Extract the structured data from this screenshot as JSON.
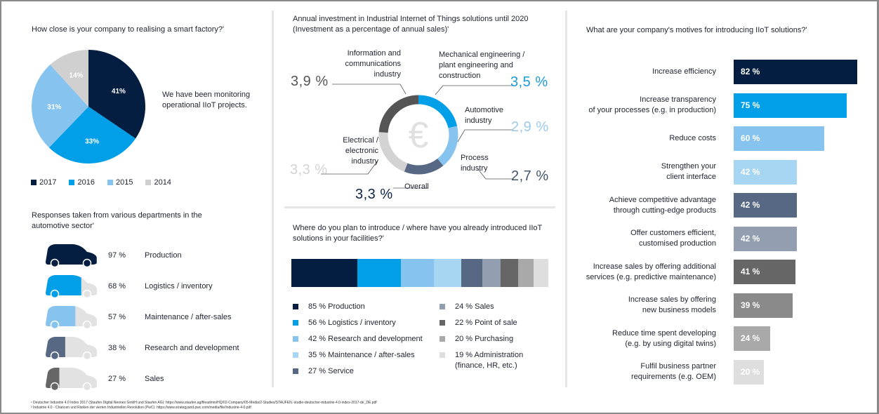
{
  "colors": {
    "navy": "#041e42",
    "blue": "#009fe8",
    "lightblue": "#87c3ef",
    "paleblue": "#a7d6f3",
    "slate": "#566883",
    "greyblue": "#939fb0",
    "darkgrey": "#666666",
    "midgrey": "#a9a9a9",
    "lightgrey": "#dedede",
    "pie2014": "#d0d0d0",
    "inactive": "#e2e2e2"
  },
  "chart_data": [
    {
      "type": "pie",
      "title": "How close is your company to realising a smart factory?'",
      "annotation": "We have been monitoring operational IIoT projects.",
      "categories": [
        "2017",
        "2016",
        "2015",
        "2014"
      ],
      "values": [
        41,
        33,
        31,
        14
      ],
      "labels": [
        "41%",
        "33%",
        "31%",
        "14%"
      ],
      "legend": "bottom"
    },
    {
      "type": "bar",
      "title": "Responses taken from various departments in the automotive sector'",
      "categories": [
        "Production",
        "Logistics / inventory",
        "Maintenance / after-sales",
        "Research and development",
        "Sales"
      ],
      "values": [
        97,
        68,
        57,
        38,
        27
      ],
      "labels": [
        "97 %",
        "68 %",
        "57 %",
        "38 %",
        "27 %"
      ]
    },
    {
      "type": "pie",
      "title": "Annual investment in Industrial Internet of Things solutions until 2020 (Investment as a percentage of annual sales)'",
      "categories": [
        "Mechanical engineering / plant engineering and construction",
        "Automotive industry",
        "Process industry",
        "Electrical / electronic industry",
        "Information and communications industry"
      ],
      "values": [
        3.5,
        2.9,
        2.7,
        3.3,
        3.9
      ],
      "labels": [
        "3,5 %",
        "2,9 %",
        "2,7 %",
        "3,3 %",
        "3,9 %"
      ],
      "overall_label": "Overall",
      "overall_value": "3,3 %",
      "center_icon": "euro-icon"
    },
    {
      "type": "bar",
      "title": "Where do you plan to introduce / where have you already introduced IIoT solutions in your facilities?'",
      "stacked": true,
      "categories": [
        "Production",
        "Logistics / inventory",
        "Research and development",
        "Maintenance / after-sales",
        "Service",
        "Sales",
        "Point of sale",
        "Purchasing",
        "Administration (finance, HR, etc.)"
      ],
      "values": [
        85,
        56,
        42,
        35,
        27,
        24,
        22,
        20,
        19
      ],
      "legend_labels": [
        "85 % Production",
        "56 % Logistics / inventory",
        "42 % Research and development",
        "35 % Maintenance / after-sales",
        "27 % Service",
        "24 % Sales",
        "22 % Point of sale",
        "20 % Purchasing",
        "19 % Administration",
        "(finance, HR, etc.)"
      ]
    },
    {
      "type": "bar",
      "orientation": "horizontal",
      "title": "What are your company's motives for introducing IIoT solutions?'",
      "categories": [
        [
          "Increase efficiency"
        ],
        [
          "Increase transparency",
          "of your processes (e.g. in production)"
        ],
        [
          "Reduce costs"
        ],
        [
          "Strengthen your",
          "client interface"
        ],
        [
          "Achieve competitive advantage",
          "through cutting-edge products"
        ],
        [
          "Offer customers efficient,",
          "customised production"
        ],
        [
          "Increase sales by offering additional",
          "services (e.g. predictive maintenance)"
        ],
        [
          "Increase sales by offering",
          "new business models"
        ],
        [
          "Reduce time spent developing",
          "(e.g. by using digital twins)"
        ],
        [
          "Fulfil business partner",
          "requirements (e.g. OEM)"
        ]
      ],
      "values": [
        82,
        75,
        60,
        42,
        42,
        42,
        41,
        39,
        24,
        20
      ],
      "labels": [
        "82 %",
        "75 %",
        "60 %",
        "42 %",
        "42 %",
        "42 %",
        "41 %",
        "39 %",
        "24 %",
        "20 %"
      ],
      "xlim": [
        0,
        100
      ]
    }
  ],
  "footnotes": [
    "¹ Deutscher Industrie 4.0 Index 2017 (Staufen Digital Neonex GmbH und Staufen AG): https://www.staufen.ag/fileadmin/HQ/02-Company/05-Media/2-Studies/STAUFEN.-studie-deutscher-industrie-4.0-index-2017-de_DE.pdf",
    "² Industrie 4.0 - Chancen und Risiken der vierten Industriellen Revolution (PwC): https://www.strategyand.pwc.com/media/file/Industrie-4-0.pdf"
  ]
}
